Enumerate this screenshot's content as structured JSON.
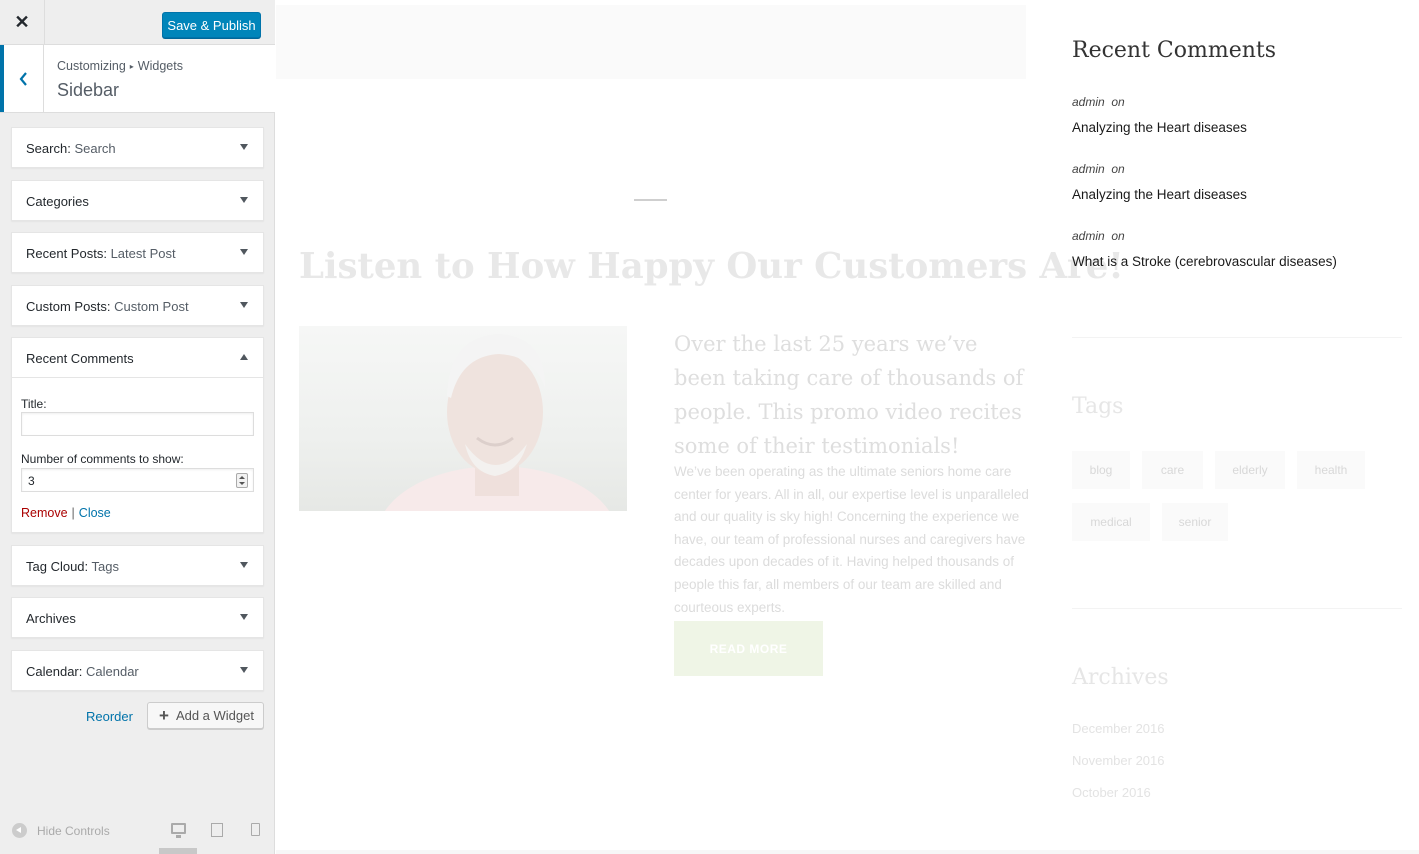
{
  "panel": {
    "close_icon": "close-icon",
    "publish_label": "Save & Publish",
    "breadcrumb": {
      "parent": "Customizing",
      "sep": "▸",
      "child": "Widgets"
    },
    "section_title": "Sidebar"
  },
  "widgets": [
    {
      "title": "Search",
      "colon": ":",
      "subtitle": " Search"
    },
    {
      "title": "Categories",
      "colon": "",
      "subtitle": ""
    },
    {
      "title": "Recent Posts",
      "colon": ":",
      "subtitle": " Latest Post"
    },
    {
      "title": "Custom Posts",
      "colon": ":",
      "subtitle": " Custom Post"
    },
    {
      "title": "Tag Cloud",
      "colon": ":",
      "subtitle": " Tags"
    },
    {
      "title": "Archives",
      "colon": "",
      "subtitle": ""
    },
    {
      "title": "Calendar",
      "colon": ":",
      "subtitle": " Calendar"
    }
  ],
  "recent_widget": {
    "title": "Recent Comments",
    "title_label": "Title:",
    "title_value": "",
    "number_label": "Number of comments to show:",
    "number_value": "3",
    "remove_label": "Remove",
    "pipe": "|",
    "close_label": "Close"
  },
  "controls": {
    "reorder_label": "Reorder",
    "add_widget_label": "Add a Widget",
    "add_icon": "+",
    "hide_controls_label": "Hide Controls"
  },
  "preview": {
    "promo_title": "Listen to How Happy Our Customers Are!",
    "promo_lead": "Over the last 25 years we’ve been taking care of thousands of people. This promo video recites some of their testimonials!",
    "promo_body": "We’ve been operating as the ultimate seniors home care center for years. All in all, our expertise level is unparalleled and our quality is sky high! Concerning the experience we have, our team of professional nurses and caregivers have decades upon decades of it. Having helped thousands of people this far, all members of our team are skilled and courteous experts.",
    "read_more": "READ MORE",
    "recent_heading": "Recent Comments",
    "comments": [
      {
        "author": "admin",
        "on": "on",
        "post": "Analyzing the Heart diseases"
      },
      {
        "author": "admin",
        "on": "on",
        "post": "Analyzing the Heart diseases"
      },
      {
        "author": "admin",
        "on": "on",
        "post": "What is a Stroke (cerebrovascular diseases)"
      }
    ],
    "tags_heading": "Tags",
    "tags": [
      "blog",
      "care",
      "elderly",
      "health",
      "medical",
      "senior"
    ],
    "archives_heading": "Archives",
    "archives": [
      "December 2016",
      "November 2016",
      "October 2016"
    ]
  },
  "colors": {
    "accent": "#0073aa",
    "publish": "#0085ba",
    "remove": "#aa0000"
  }
}
